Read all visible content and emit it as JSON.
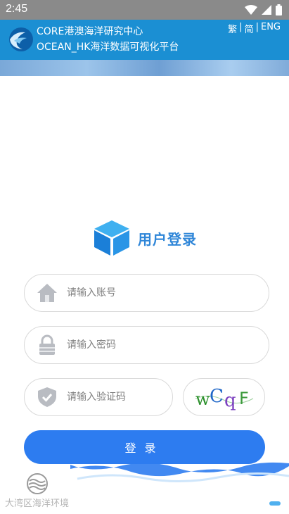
{
  "status_bar": {
    "time": "2:45"
  },
  "header": {
    "org_name": "CORE港澳海洋研究中心",
    "platform_name": "OCEAN_HK海洋数据可视化平台",
    "lang_options": [
      "繁",
      "简",
      "ENG"
    ],
    "lang_separator": "|"
  },
  "login": {
    "title": "用户登录",
    "account_placeholder": "请输入账号",
    "password_placeholder": "请输入密码",
    "captcha_placeholder": "请输入验证码",
    "captcha_chars": [
      "w",
      "C",
      "q",
      "F"
    ],
    "button_label": "登录"
  },
  "bottom_nav": {
    "items": [
      {
        "label": "大湾区海洋环境",
        "icon": "waves-icon"
      }
    ]
  },
  "colors": {
    "header_bg": "#1b8fd3",
    "title": "#2f86d8",
    "button_bg": "#2d7cf0",
    "captcha": [
      "#2a8f2a",
      "#1e66c8",
      "#7b3fbf",
      "#3c9a3c"
    ]
  }
}
